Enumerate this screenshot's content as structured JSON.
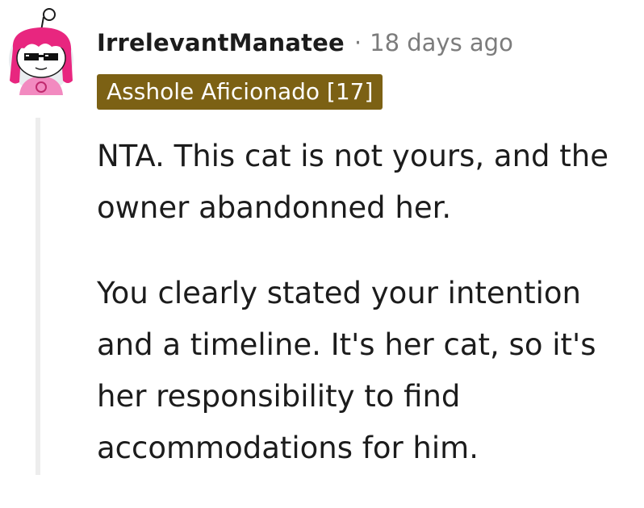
{
  "comment": {
    "author": "IrrelevantManatee",
    "separator": "·",
    "timestamp": "18 days ago",
    "flair": "Asshole Aficionado [17]",
    "flair_color": "#7c6114",
    "avatar_icon": "snoo-avatar-pink-hair-sunglasses",
    "paragraphs": [
      "NTA. This cat is not yours, and the owner abandonned her.",
      "You clearly stated your intention and a timeline. It's her cat, so it's her responsibility to find accommodations for him."
    ]
  }
}
